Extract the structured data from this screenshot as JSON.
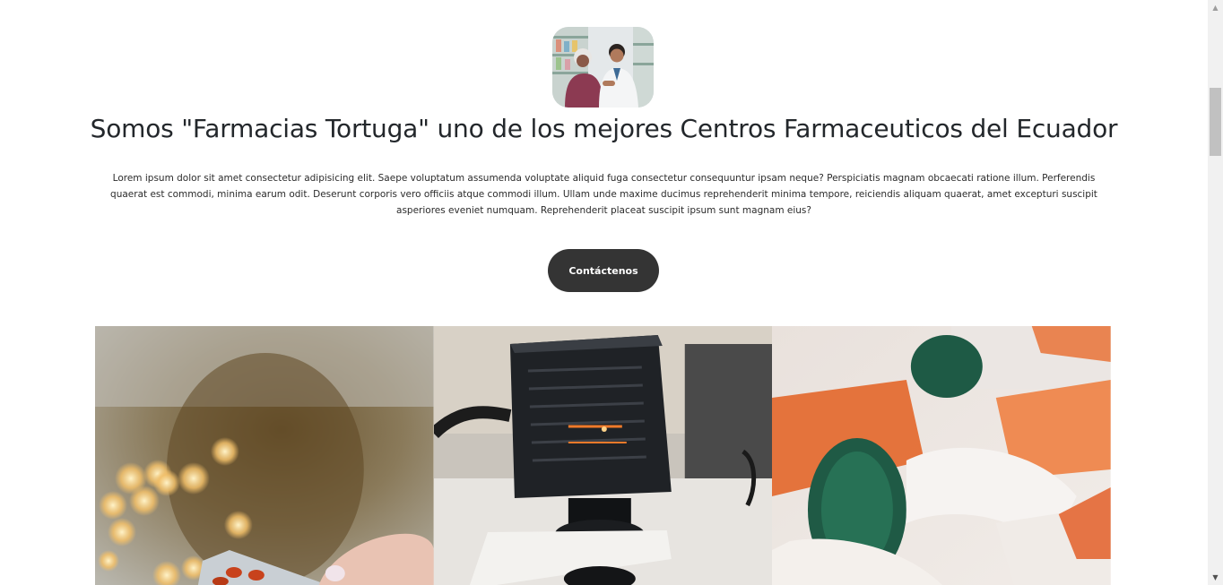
{
  "hero": {
    "headline": "Somos \"Farmacias Tortuga\" uno de los mejores Centros Farmaceuticos del Ecuador",
    "description": "Lorem ipsum dolor sit amet consectetur adipisicing elit. Saepe voluptatum assumenda voluptate aliquid fuga consectetur consequuntur ipsam neque? Perspiciatis magnam obcaecati ratione illum. Perferendis quaerat est commodi, minima earum odit. Deserunt corporis vero officiis atque commodi illum. Ullam unde maxime ducimus reprehenderit minima tempore, reiciendis aliquam quaerat, amet excepturi suscipit asperiores eveniet numquam. Reprehenderit placeat suscipit ipsum sunt magnam eius?",
    "cta_label": "Contáctenos",
    "avatar_icon": "pharmacist-photo-icon"
  },
  "gallery": {
    "tiles": [
      {
        "icon": "pill-blister-photo-icon"
      },
      {
        "icon": "lab-device-photo-icon"
      },
      {
        "icon": "capsules-photo-icon"
      }
    ]
  },
  "colors": {
    "button_bg": "#343434",
    "button_text": "#ffffff",
    "headline": "#23272b"
  }
}
